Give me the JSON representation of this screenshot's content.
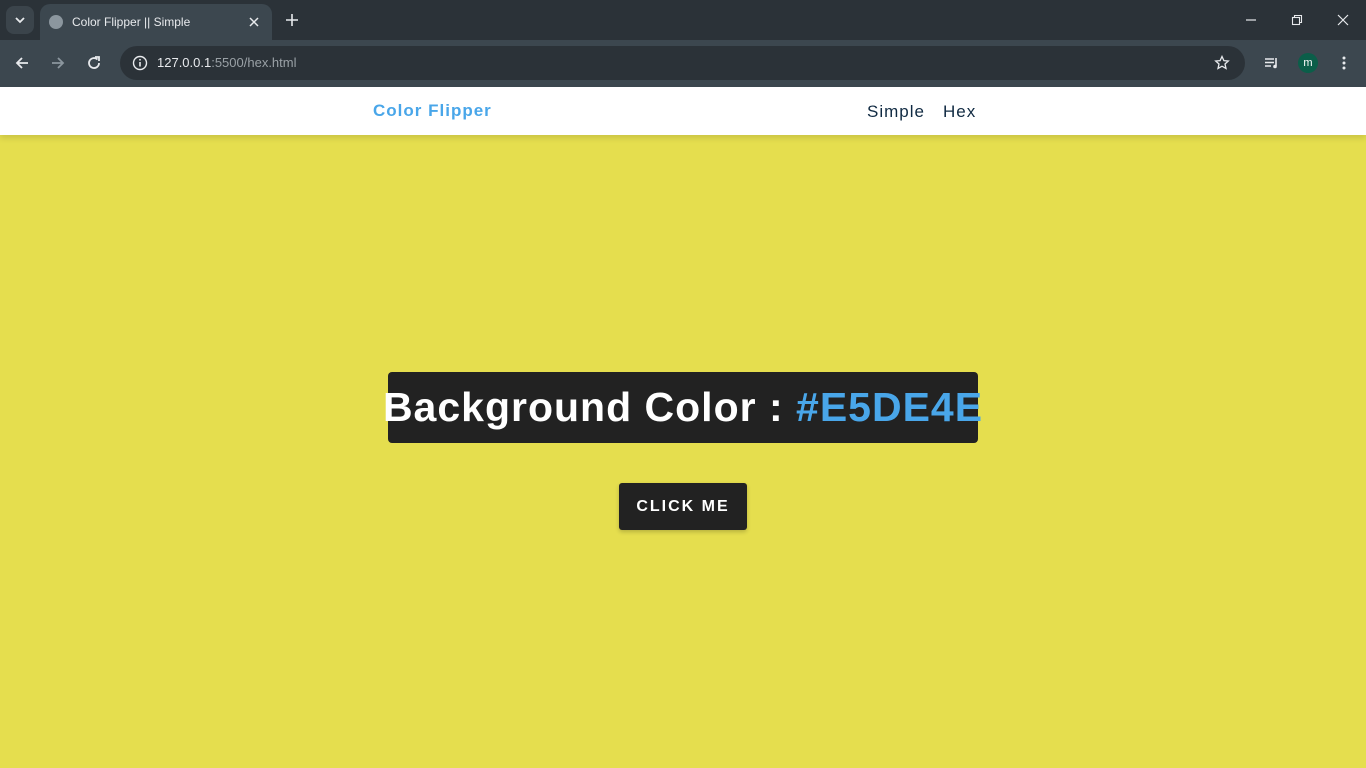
{
  "browser": {
    "tab_title": "Color Flipper || Simple",
    "url_host": "127.0.0.1",
    "url_rest": ":5500/hex.html",
    "profile_initial": "m"
  },
  "page": {
    "brand": "Color Flipper",
    "nav_links": [
      "Simple",
      "Hex"
    ],
    "heading_prefix": "Background Color : ",
    "color_value": "#E5DE4E",
    "button_label": "CLICK ME"
  },
  "colors": {
    "background": "#E5DE4E",
    "accent": "#49a6e9",
    "dark": "#222222",
    "nav_text": "#102a42"
  }
}
